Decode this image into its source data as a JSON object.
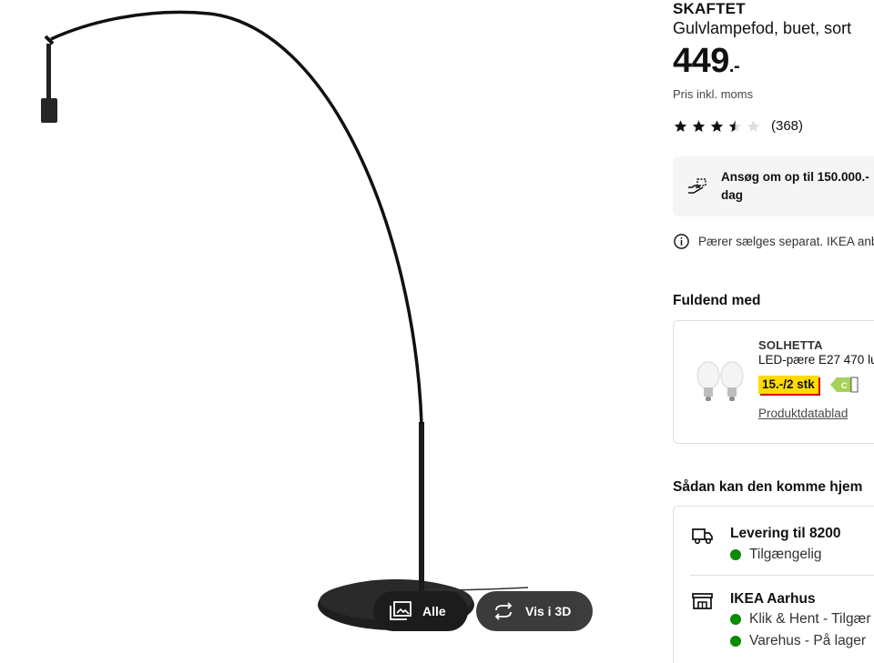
{
  "product": {
    "name": "SKAFTET",
    "description": "Gulvlampefod, buet, sort",
    "price": "449",
    "price_suffix": ".-",
    "vat_note": "Pris inkl. moms",
    "rating": 3.5,
    "rating_max": 5,
    "review_count": "(368)"
  },
  "media": {
    "all_button": "Alle",
    "view3d_button": "Vis i 3D"
  },
  "finance": {
    "line1": "Ansøg om op til 150.000.-",
    "line2": "dag"
  },
  "info": {
    "text": "Pærer sælges separat. IKEA anb"
  },
  "accessories": {
    "heading": "Fuldend med",
    "item": {
      "name": "SOLHETTA",
      "description": "LED-pære E27 470 lu",
      "price": "15.-/2 stk",
      "energy_class": "C",
      "link": "Produktdatablad"
    }
  },
  "delivery": {
    "heading": "Sådan kan den komme hjem",
    "options": [
      {
        "title": "Levering til 8200",
        "statuses": [
          "Tilgængelig"
        ]
      },
      {
        "title": "IKEA Aarhus",
        "statuses": [
          "Klik & Hent - Tilgær",
          "Varehus - På lager"
        ]
      }
    ]
  },
  "colors": {
    "availability_green": "#0a8a00",
    "price_tag_yellow": "#ffdb00",
    "energy_green": "#a6d15a"
  }
}
